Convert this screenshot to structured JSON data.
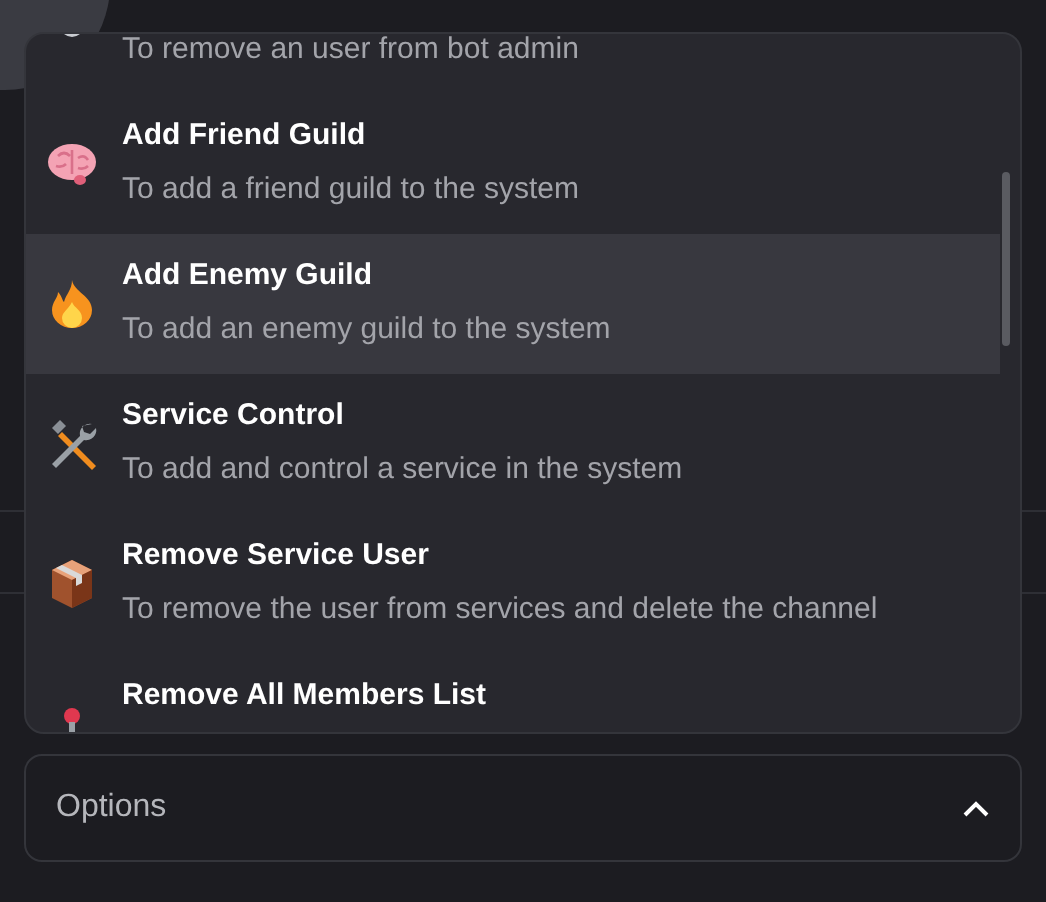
{
  "menu": {
    "items": [
      {
        "kind": "admin",
        "description": "To remove an user from bot admin",
        "selected": false
      },
      {
        "kind": "brain",
        "title": "Add Friend Guild",
        "description": "To add a friend guild to the system",
        "selected": false
      },
      {
        "kind": "fire",
        "title": "Add Enemy Guild",
        "description": "To add an enemy guild to the system",
        "selected": true
      },
      {
        "kind": "tools",
        "title": "Service Control",
        "description": "To add and control a service in the system",
        "selected": false
      },
      {
        "kind": "package",
        "title": "Remove Service User",
        "description": "To remove the user from services and delete the channel",
        "selected": false
      },
      {
        "kind": "joystick",
        "title": "Remove All Members List",
        "selected": false
      }
    ]
  },
  "select": {
    "placeholder": "Options",
    "expanded": true
  }
}
